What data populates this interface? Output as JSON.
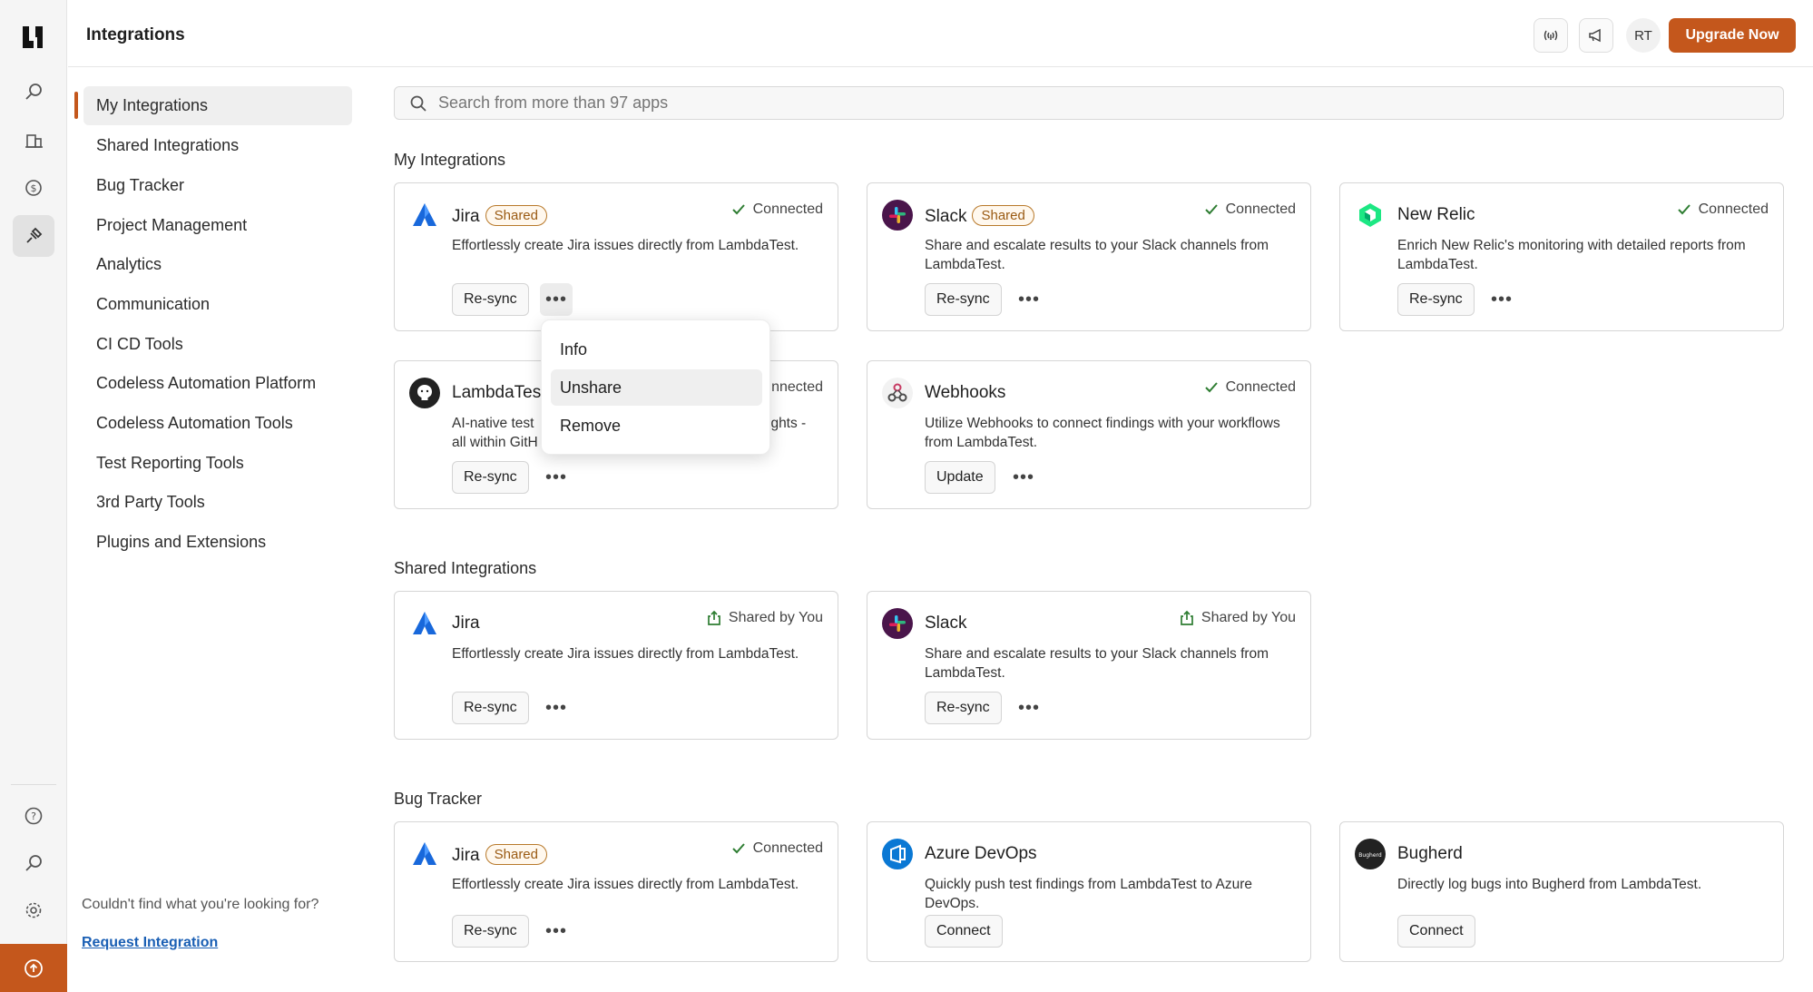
{
  "header": {
    "title": "Integrations",
    "avatar_initials": "RT",
    "upgrade_label": "Upgrade Now"
  },
  "rail": {
    "icons": [
      "search-icon",
      "building-icon",
      "dollar-icon",
      "plug-icon",
      "help-icon",
      "search-icon",
      "settings-icon",
      "upload-icon"
    ],
    "active": "plug-icon"
  },
  "sidebar": {
    "items": [
      {
        "label": "My Integrations"
      },
      {
        "label": "Shared Integrations"
      },
      {
        "label": "Bug Tracker"
      },
      {
        "label": "Project Management"
      },
      {
        "label": "Analytics"
      },
      {
        "label": "Communication"
      },
      {
        "label": "CI CD Tools"
      },
      {
        "label": "Codeless Automation Platform"
      },
      {
        "label": "Codeless Automation Tools"
      },
      {
        "label": "Test Reporting Tools"
      },
      {
        "label": "3rd Party Tools"
      },
      {
        "label": "Plugins and Extensions"
      }
    ],
    "active": "My Integrations",
    "cant_find": "Couldn't find what you're looking for?",
    "request_link": "Request Integration"
  },
  "search": {
    "placeholder": "Search from more than 97 apps"
  },
  "sections": {
    "my": "My Integrations",
    "shared": "Shared Integrations",
    "bug": "Bug Tracker"
  },
  "cards": {
    "my_jira": {
      "name": "Jira",
      "badge": "Shared",
      "status": "Connected",
      "desc": "Effortlessly create Jira issues directly from LambdaTest.",
      "action": "Re-sync",
      "more": "•••"
    },
    "my_slack": {
      "name": "Slack",
      "badge": "Shared",
      "status": "Connected",
      "desc": "Share and escalate results to your Slack channels from LambdaTest.",
      "action": "Re-sync",
      "more": "•••"
    },
    "my_newrelic": {
      "name": "New Relic",
      "status": "Connected",
      "desc": "Enrich New Relic's monitoring with detailed reports from LambdaTest.",
      "action": "Re-sync",
      "more": "•••"
    },
    "my_lambdatest": {
      "name": "LambdaTes",
      "status": "nnected",
      "desc_left": "AI-native test",
      "desc_left2": "all within GitH",
      "desc_right": "ights -",
      "action": "Re-sync",
      "more": "•••"
    },
    "my_webhooks": {
      "name": "Webhooks",
      "status": "Connected",
      "desc": "Utilize Webhooks to connect findings with your workflows from LambdaTest.",
      "action": "Update",
      "more": "•••"
    },
    "sh_jira": {
      "name": "Jira",
      "status": "Shared by You",
      "desc": "Effortlessly create Jira issues directly from LambdaTest.",
      "action": "Re-sync",
      "more": "•••"
    },
    "sh_slack": {
      "name": "Slack",
      "status": "Shared by You",
      "desc": "Share and escalate results to your Slack channels from LambdaTest.",
      "action": "Re-sync",
      "more": "•••"
    },
    "bug_jira": {
      "name": "Jira",
      "badge": "Shared",
      "status": "Connected",
      "desc": "Effortlessly create Jira issues directly from LambdaTest.",
      "action": "Re-sync",
      "more": "•••"
    },
    "bug_azure": {
      "name": "Azure DevOps",
      "desc": "Quickly push test findings from LambdaTest to Azure DevOps.",
      "action": "Connect"
    },
    "bug_bugherd": {
      "name": "Bugherd",
      "desc": "Directly log bugs into Bugherd from LambdaTest.",
      "action": "Connect",
      "logo_text": "Bugherd"
    }
  },
  "menu": {
    "items": [
      "Info",
      "Unshare",
      "Remove"
    ],
    "highlighted": "Unshare"
  },
  "colors": {
    "accent": "#c4571c",
    "connected_check": "#2e7d32",
    "badge_border": "#b8792a"
  }
}
